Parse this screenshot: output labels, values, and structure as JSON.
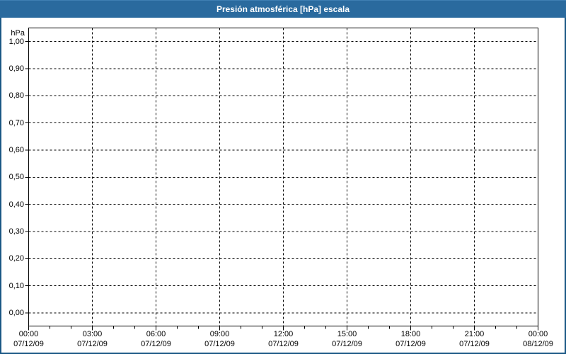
{
  "header": {
    "title": "Presión atmosférica [hPa] escala"
  },
  "colors": {
    "header_bg": "#2a6a9e",
    "frame_border": "#1b5885",
    "plot_border": "#000000",
    "grid": "#000000",
    "text": "#000000",
    "title_text": "#ffffff",
    "background": "#ffffff"
  },
  "chart_data": {
    "type": "line",
    "title": "Presión atmosférica [hPa] escala",
    "ylabel": "hPa",
    "ylim": [
      0.0,
      1.0
    ],
    "ytick_step": 0.1,
    "ytick_labels": [
      "1,00",
      "0,90",
      "0,80",
      "0,70",
      "0,60",
      "0,50",
      "0,40",
      "0,30",
      "0,20",
      "0,10",
      "0,00"
    ],
    "xticks": [
      {
        "time": "00:00",
        "date": "07/12/09"
      },
      {
        "time": "03:00",
        "date": "07/12/09"
      },
      {
        "time": "06:00",
        "date": "07/12/09"
      },
      {
        "time": "09:00",
        "date": "07/12/09"
      },
      {
        "time": "12:00",
        "date": "07/12/09"
      },
      {
        "time": "15:00",
        "date": "07/12/09"
      },
      {
        "time": "18:00",
        "date": "07/12/09"
      },
      {
        "time": "21:00",
        "date": "07/12/09"
      },
      {
        "time": "00:00",
        "date": "08/12/09"
      }
    ],
    "x_major_interval_hours": 3,
    "x_minor_interval_hours": 1,
    "grid": "dashed",
    "legend": null,
    "series": []
  }
}
